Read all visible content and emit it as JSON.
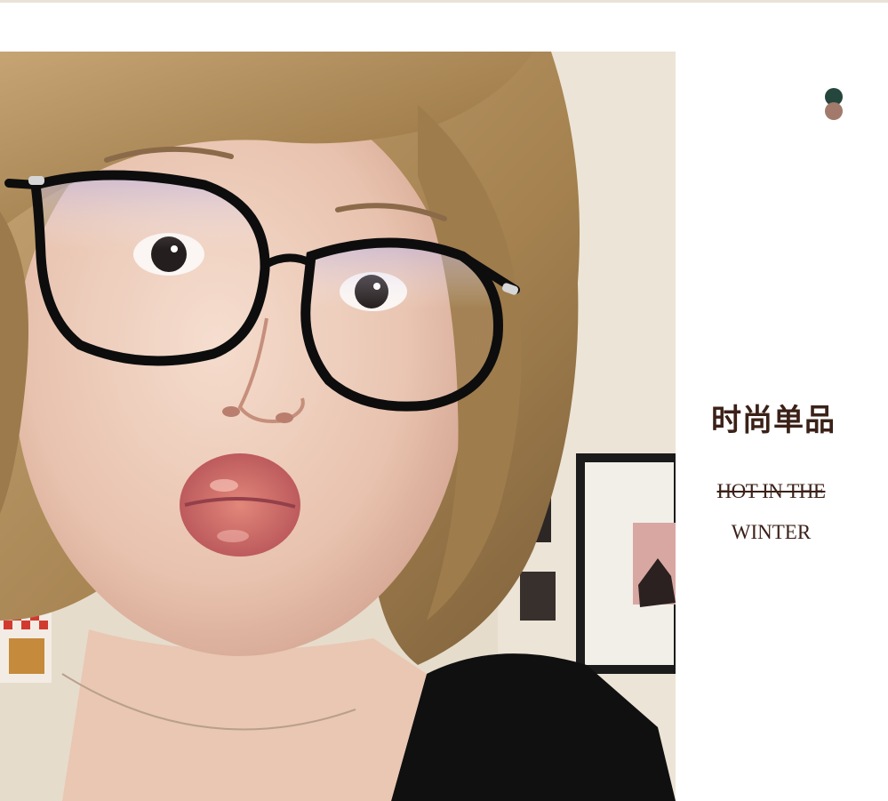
{
  "colors": {
    "text": "#3b2118",
    "dot_top": "#24463c",
    "dot_bottom": "#a27a6c"
  },
  "banner": {
    "title_cn": "时尚单品",
    "subtitle_line1": "HOT IN THE",
    "subtitle_line2": "WINTER"
  }
}
